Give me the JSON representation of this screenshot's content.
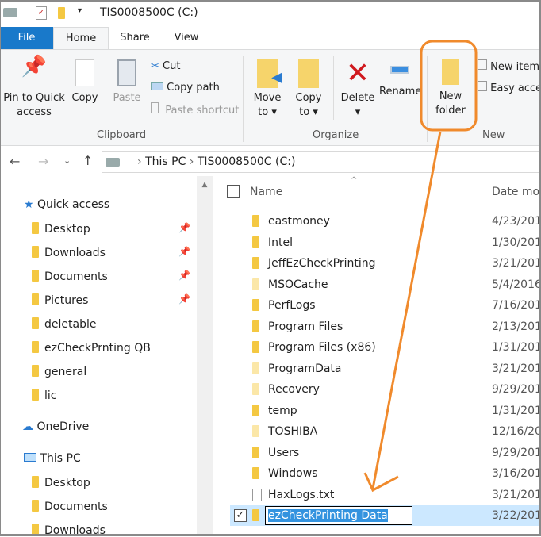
{
  "window": {
    "title": "TIS0008500C (C:)"
  },
  "tabs": [
    {
      "label": "File"
    },
    {
      "label": "Home"
    },
    {
      "label": "Share"
    },
    {
      "label": "View"
    }
  ],
  "ribbon": {
    "clipboard": {
      "group": "Clipboard",
      "pin": "Pin to Quick",
      "pin2": "access",
      "copy": "Copy",
      "paste": "Paste",
      "cut": "Cut",
      "copy_path": "Copy path",
      "paste_shortcut": "Paste shortcut"
    },
    "organize": {
      "group": "Organize",
      "move": "Move",
      "move2": "to",
      "copy": "Copy",
      "copy2": "to",
      "delete": "Delete",
      "rename": "Rename"
    },
    "new": {
      "group": "New",
      "new_folder": "New",
      "new_folder2": "folder",
      "new_item": "New item",
      "easy_access": "Easy access"
    }
  },
  "address": {
    "crumbs": [
      "This PC",
      "TIS0008500C (C:)"
    ]
  },
  "nav": {
    "quick_access": "Quick access",
    "quick_items": [
      {
        "label": "Desktop",
        "pinned": true
      },
      {
        "label": "Downloads",
        "pinned": true
      },
      {
        "label": "Documents",
        "pinned": true
      },
      {
        "label": "Pictures",
        "pinned": true
      },
      {
        "label": "deletable"
      },
      {
        "label": "ezCheckPrnting QB"
      },
      {
        "label": "general"
      },
      {
        "label": "lic"
      }
    ],
    "onedrive": "OneDrive",
    "this_pc": "This PC",
    "pc_items": [
      {
        "label": "Desktop"
      },
      {
        "label": "Documents"
      },
      {
        "label": "Downloads"
      }
    ]
  },
  "list": {
    "columns": {
      "name": "Name",
      "date": "Date mod"
    },
    "rows": [
      {
        "name": "eastmoney",
        "date": "4/23/201"
      },
      {
        "name": "Intel",
        "date": "1/30/201"
      },
      {
        "name": "JeffEzCheckPrinting",
        "date": "3/21/201"
      },
      {
        "name": "MSOCache",
        "date": "5/4/2016",
        "pale": true
      },
      {
        "name": "PerfLogs",
        "date": "7/16/201"
      },
      {
        "name": "Program Files",
        "date": "2/13/201"
      },
      {
        "name": "Program Files (x86)",
        "date": "1/31/201"
      },
      {
        "name": "ProgramData",
        "date": "3/21/201",
        "pale": true
      },
      {
        "name": "Recovery",
        "date": "9/29/201",
        "pale": true
      },
      {
        "name": "temp",
        "date": "1/31/201"
      },
      {
        "name": "TOSHIBA",
        "date": "12/16/20",
        "pale": true
      },
      {
        "name": "Users",
        "date": "9/29/201"
      },
      {
        "name": "Windows",
        "date": "3/16/201"
      },
      {
        "name": "HaxLogs.txt",
        "date": "3/21/201",
        "file": true
      }
    ],
    "editing": {
      "name": "ezCheckPrinting Data",
      "date": "3/22/201"
    }
  },
  "colors": {
    "accent": "#1979ca",
    "annotation": "#f08a2c",
    "selection": "#cce8ff"
  }
}
